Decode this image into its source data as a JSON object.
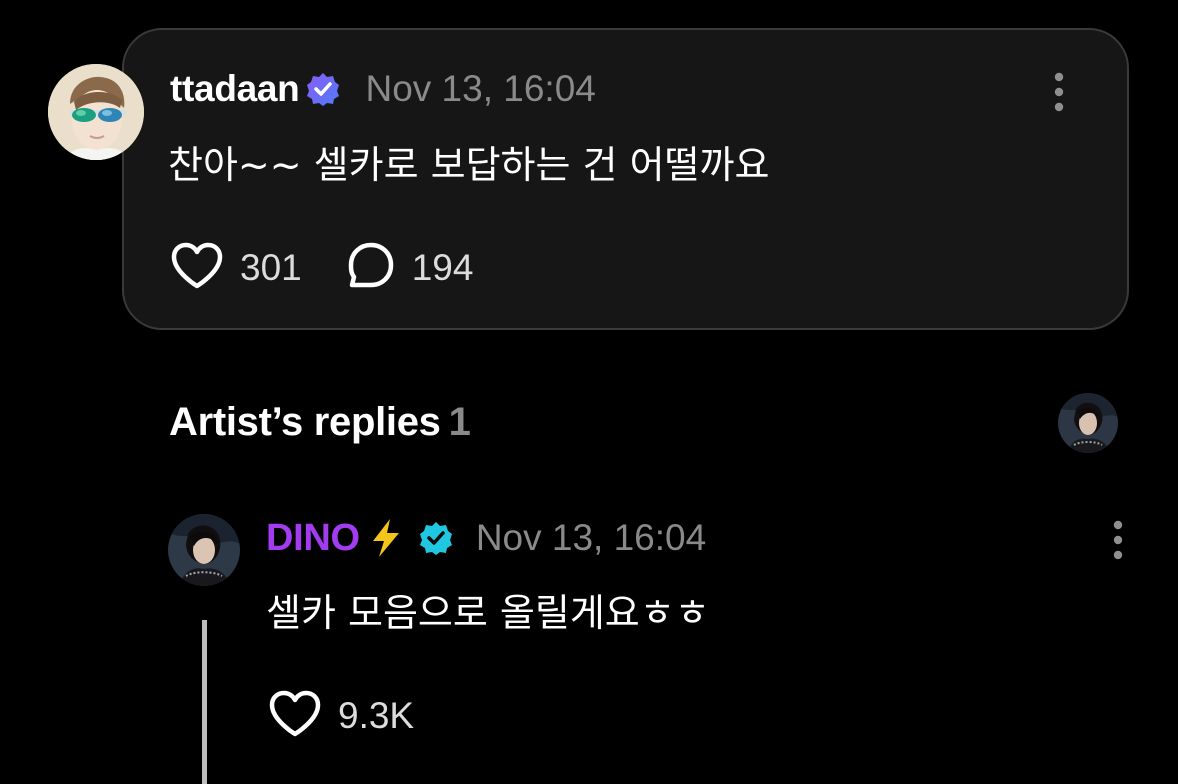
{
  "comment": {
    "username": "ttadaan",
    "timestamp": "Nov 13, 16:04",
    "text": "찬아~~ 셀카로 보답하는 건 어떨까요",
    "like_count": "301",
    "reply_count": "194"
  },
  "artist_replies": {
    "title": "Artist’s replies",
    "count": "1"
  },
  "reply": {
    "artist_name": "DINO",
    "timestamp": "Nov 13, 16:04",
    "text": "셀카 모음으로 올릴게요ㅎㅎ",
    "like_count": "9.3K"
  },
  "colors": {
    "background": "#000000",
    "card": "#161616",
    "card_border": "#3a3a3a",
    "muted_text": "#8a8a8a",
    "artist_name": "#a33cf0",
    "verified_user_badge": "#6f5cf6",
    "verified_artist_badge": "#1fc7e0",
    "bolt": "#f5c51b"
  },
  "icons": {
    "comment_verified": "verified-badge-icon",
    "artist_verified": "verified-artist-badge-icon",
    "artist_emoji": "lightning-bolt-icon",
    "like": "heart-icon",
    "reply": "speech-bubble-icon",
    "more": "more-vertical-icon"
  }
}
